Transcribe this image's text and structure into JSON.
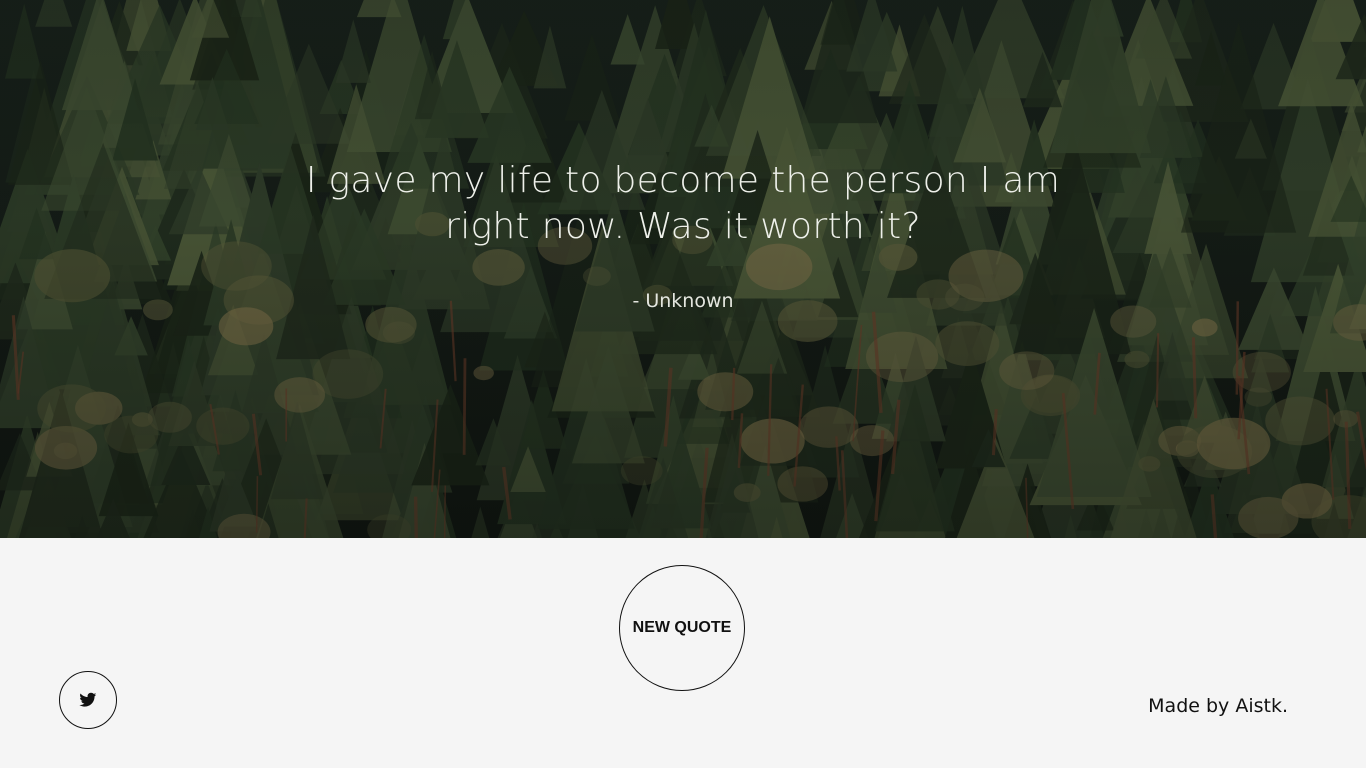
{
  "quote": {
    "text": "I gave my life to become the person I am right now. Was it worth it?",
    "author": "- Unknown"
  },
  "buttons": {
    "new_quote_label": "NEW QUOTE"
  },
  "share": {
    "icon": "twitter-icon"
  },
  "footer": {
    "credit": "Made by Aistk."
  },
  "colors": {
    "hero_overlay_text": "#eef0ea",
    "footer_background": "#f5f5f5",
    "button_border": "#111111"
  }
}
